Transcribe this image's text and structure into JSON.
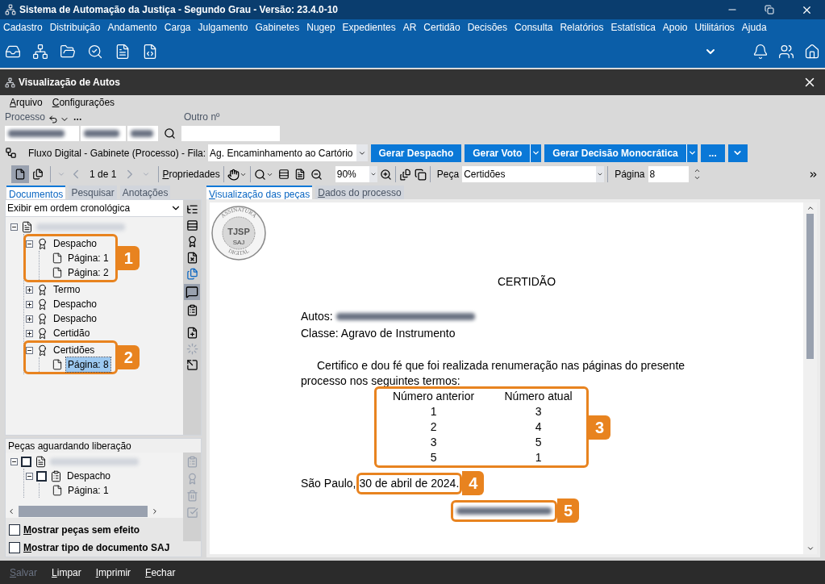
{
  "title_bar": {
    "title": "Sistema de Automação da Justiça - Segundo Grau - Versão: 23.4.0-10"
  },
  "menu": [
    "Cadastro",
    "Distribuição",
    "Andamento",
    "Carga",
    "Julgamento",
    "Gabinetes",
    "Nugep",
    "Expedientes",
    "AR",
    "Certidão",
    "Decisões",
    "Consulta",
    "Relatórios",
    "Estatística",
    "Apoio",
    "Utilitários",
    "Ajuda"
  ],
  "subwindow": {
    "title": "Visualização de Autos"
  },
  "submenu": [
    "Arquivo",
    "Configurações"
  ],
  "process": {
    "label": "Processo",
    "other_label": "Outro nº"
  },
  "flow": {
    "label": "Fluxo Digital - Gabinete (Processo) - Fila:",
    "queue": "Ag. Encaminhamento ao Cartório",
    "buttons": [
      {
        "label": "Gerar Despacho",
        "kind": "plain"
      },
      {
        "label": "Gerar Voto",
        "kind": "split"
      },
      {
        "label": "Gerar Decisão Monocrática",
        "kind": "split"
      },
      {
        "label": "...",
        "kind": "plain"
      }
    ]
  },
  "viewer_toolbar": {
    "page_count": "1 de 1",
    "properties": "Propriedades",
    "zoom": "90%",
    "piece_label": "Peça",
    "piece": "Certidões",
    "page_label": "Página",
    "page": "8"
  },
  "left_tabs": [
    {
      "label": "Documentos",
      "selected": true
    },
    {
      "label": "Pesquisar",
      "selected": false
    },
    {
      "label": "Anotações",
      "selected": false
    }
  ],
  "order": "Exibir em ordem cronológica",
  "tree": [
    {
      "kind": "process",
      "expanded": true,
      "children": [
        {
          "kind": "piece",
          "label": "Despacho",
          "expanded": true,
          "selected": false,
          "callout": "1",
          "children": [
            {
              "kind": "page",
              "label": "Página: 1",
              "selected": false
            },
            {
              "kind": "page",
              "label": "Página: 2",
              "selected": false
            }
          ]
        },
        {
          "kind": "piece",
          "label": "Termo",
          "expanded": false,
          "selected": false
        },
        {
          "kind": "piece",
          "label": "Despacho",
          "expanded": false,
          "selected": false
        },
        {
          "kind": "piece",
          "label": "Despacho",
          "expanded": false,
          "selected": false
        },
        {
          "kind": "piece",
          "label": "Certidão",
          "expanded": false,
          "selected": false
        },
        {
          "kind": "piece",
          "label": "Certidões",
          "expanded": true,
          "selected": false,
          "callout": "2",
          "children": [
            {
              "kind": "page",
              "label": "Página: 8",
              "selected": true
            }
          ]
        }
      ]
    }
  ],
  "pending": {
    "title": "Peças aguardando liberação",
    "tree": [
      {
        "kind": "process",
        "checked": false,
        "expanded": true,
        "children": [
          {
            "kind": "document",
            "label": "Despacho",
            "checked": false,
            "expanded": true,
            "children": [
              {
                "kind": "page",
                "label": "Página: 1"
              }
            ]
          }
        ]
      }
    ]
  },
  "options": [
    {
      "label": "Mostrar peças sem efeito",
      "checked": false
    },
    {
      "label": "Mostrar tipo de documento SAJ",
      "checked": false
    }
  ],
  "right_tabs": [
    {
      "label": "Visualização das peças",
      "selected": true
    },
    {
      "label": "Dados do processo",
      "selected": false
    }
  ],
  "document": {
    "seal": {
      "top": "ASSINATURA",
      "center": "TJSP",
      "small": "SAJ",
      "bottom": "DIGITAL"
    },
    "title": "CERTIDÃO",
    "autos_label": "Autos:",
    "class_line": "Classe: Agravo de Instrumento",
    "paragraph": "Certifico e dou fé que foi realizada renumeração nas páginas do presente processo nos seguintes termos:",
    "table": {
      "callout": "3",
      "columns": [
        "Número anterior",
        "Número atual"
      ],
      "rows": [
        [
          "1",
          "3"
        ],
        [
          "2",
          "4"
        ],
        [
          "3",
          "5"
        ],
        [
          "5",
          "1"
        ]
      ]
    },
    "place": "São Paulo,",
    "date": "30 de abril de 2024.",
    "date_callout": "4",
    "signature_callout": "5"
  },
  "footer": [
    {
      "label": "Salvar",
      "disabled": true
    },
    {
      "label": "Limpar",
      "disabled": false
    },
    {
      "label": "Imprimir",
      "disabled": false
    },
    {
      "label": "Fechar",
      "disabled": false
    }
  ]
}
